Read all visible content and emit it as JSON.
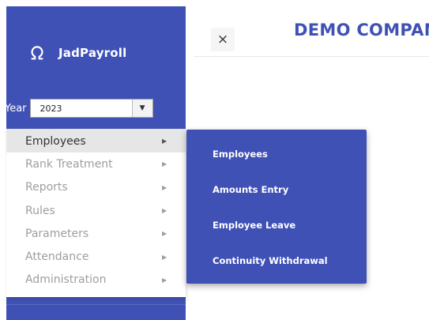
{
  "brand": {
    "name": "JadPayroll",
    "icon": "omega-logo-icon"
  },
  "year": {
    "label": "Year",
    "selected": "2023"
  },
  "menu": {
    "items": [
      {
        "label": "Employees",
        "active": true
      },
      {
        "label": "Rank Treatment",
        "active": false
      },
      {
        "label": "Reports",
        "active": false
      },
      {
        "label": "Rules",
        "active": false
      },
      {
        "label": "Parameters",
        "active": false
      },
      {
        "label": "Attendance",
        "active": false
      },
      {
        "label": "Administration",
        "active": false
      }
    ]
  },
  "submenu": {
    "items": [
      {
        "label": "Employees"
      },
      {
        "label": "Amounts Entry"
      },
      {
        "label": "Employee Leave"
      },
      {
        "label": "Continuity Withdrawal"
      }
    ]
  },
  "header": {
    "close_label": "×",
    "company": "DEMO COMPANY"
  },
  "colors": {
    "primary": "#3f51b5",
    "menu_active_bg": "#e6e6e6",
    "menu_text": "#9e9e9e"
  }
}
